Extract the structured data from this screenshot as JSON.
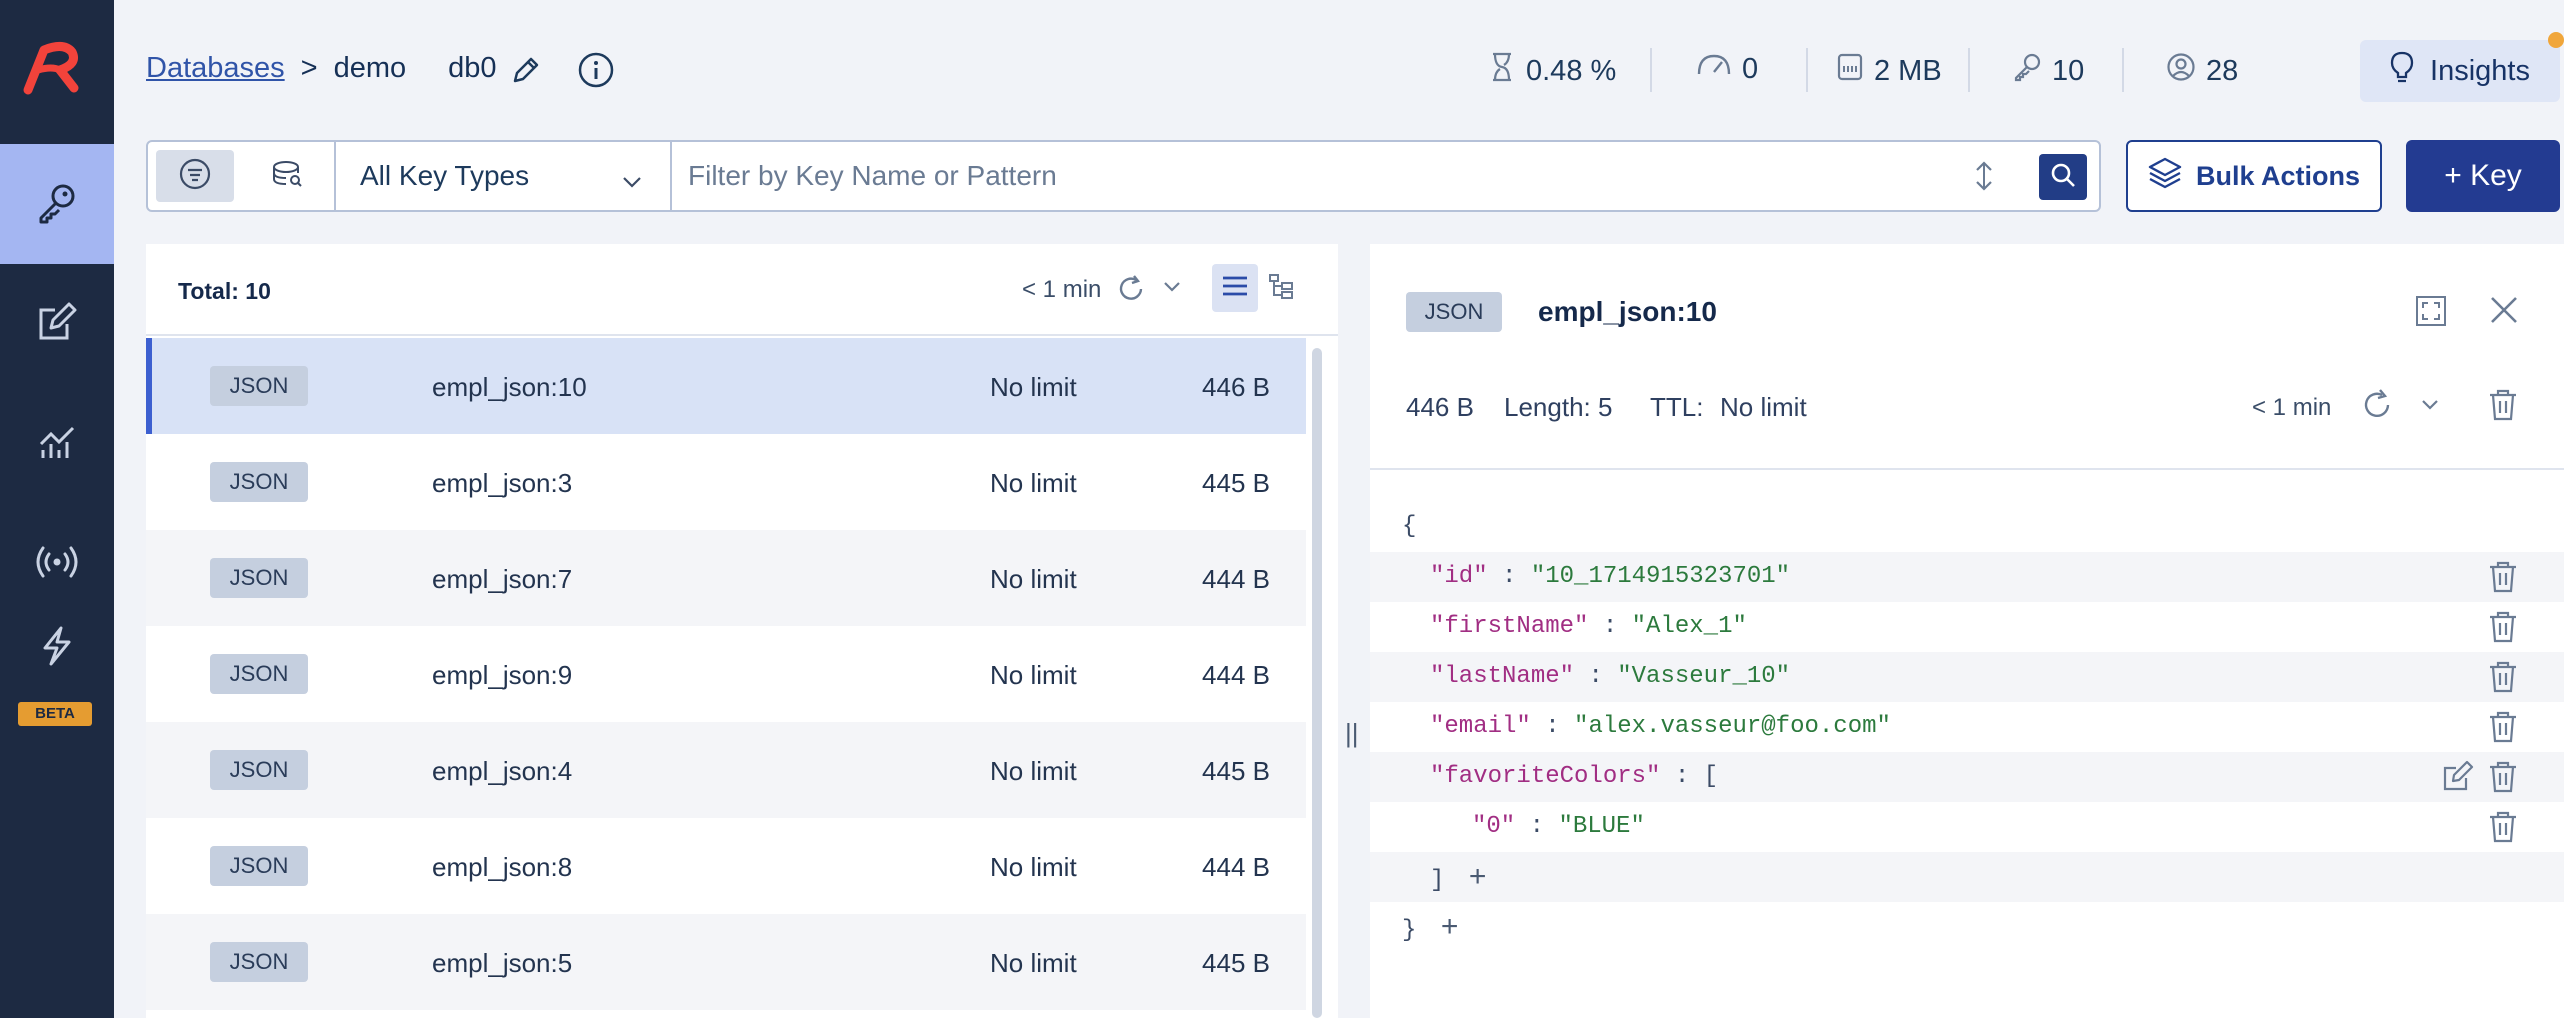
{
  "header": {
    "breadcrumb_root": "Databases",
    "breadcrumb_sep": ">",
    "breadcrumb_db": "demo",
    "db_index": "db0",
    "stats": {
      "cpu": "0.48 %",
      "ops": "0",
      "memory": "2 MB",
      "keys": "10",
      "clients": "28"
    },
    "insights_label": "Insights"
  },
  "nav": {
    "beta_label": "BETA"
  },
  "filter": {
    "key_type": "All Key Types",
    "search_placeholder": "Filter by Key Name or Pattern",
    "bulk_actions_label": "Bulk Actions",
    "add_key_label": "+ Key"
  },
  "list": {
    "total_label": "Total: 10",
    "refresh_label": "< 1 min",
    "rows": [
      {
        "type": "JSON",
        "name": "empl_json:10",
        "ttl": "No limit",
        "size": "446 B"
      },
      {
        "type": "JSON",
        "name": "empl_json:3",
        "ttl": "No limit",
        "size": "445 B"
      },
      {
        "type": "JSON",
        "name": "empl_json:7",
        "ttl": "No limit",
        "size": "444 B"
      },
      {
        "type": "JSON",
        "name": "empl_json:9",
        "ttl": "No limit",
        "size": "444 B"
      },
      {
        "type": "JSON",
        "name": "empl_json:4",
        "ttl": "No limit",
        "size": "445 B"
      },
      {
        "type": "JSON",
        "name": "empl_json:8",
        "ttl": "No limit",
        "size": "444 B"
      },
      {
        "type": "JSON",
        "name": "empl_json:5",
        "ttl": "No limit",
        "size": "445 B"
      }
    ]
  },
  "detail": {
    "type": "JSON",
    "key_name": "empl_json:10",
    "size": "446 B",
    "length": "Length: 5",
    "ttl_label": "TTL:",
    "ttl_value": "No limit",
    "refresh_label": "< 1 min",
    "json": {
      "open_brace": "{",
      "close_brace": "}",
      "id_key": "\"id\"",
      "id_val": "\"10_1714915323701\"",
      "first_key": "\"firstName\"",
      "first_val": "\"Alex_1\"",
      "last_key": "\"lastName\"",
      "last_val": "\"Vasseur_10\"",
      "email_key": "\"email\"",
      "email_val": "\"alex.vasseur@foo.com\"",
      "colors_key": "\"favoriteColors\"",
      "open_bracket": "[",
      "close_bracket": "]",
      "color0_key": "\"0\"",
      "color0_val": "\"BLUE\"",
      "colon": ":",
      "plus": "+"
    }
  }
}
